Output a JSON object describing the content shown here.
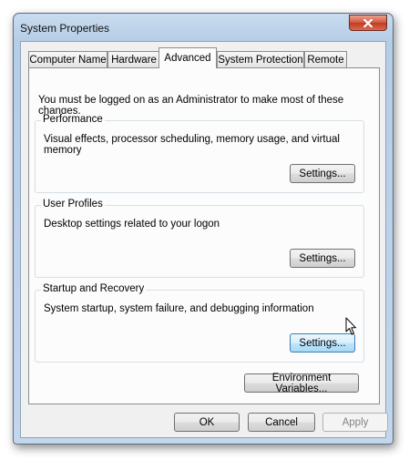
{
  "window": {
    "title": "System Properties",
    "close_icon": "close-x-icon"
  },
  "tabs": [
    {
      "label": "Computer Name",
      "active": false
    },
    {
      "label": "Hardware",
      "active": false
    },
    {
      "label": "Advanced",
      "active": true
    },
    {
      "label": "System Protection",
      "active": false
    },
    {
      "label": "Remote",
      "active": false
    }
  ],
  "advanced": {
    "intro": "You must be logged on as an Administrator to make most of these changes.",
    "performance": {
      "title": "Performance",
      "description": "Visual effects, processor scheduling, memory usage, and virtual memory",
      "button": "Settings..."
    },
    "user_profiles": {
      "title": "User Profiles",
      "description": "Desktop settings related to your logon",
      "button": "Settings..."
    },
    "startup_recovery": {
      "title": "Startup and Recovery",
      "description": "System startup, system failure, and debugging information",
      "button": "Settings..."
    },
    "env_vars_button": "Environment Variables..."
  },
  "dialog_buttons": {
    "ok": "OK",
    "cancel": "Cancel",
    "apply": "Apply"
  },
  "colors": {
    "hover_button": "#bee6fd",
    "close_button": "#c23a22"
  }
}
